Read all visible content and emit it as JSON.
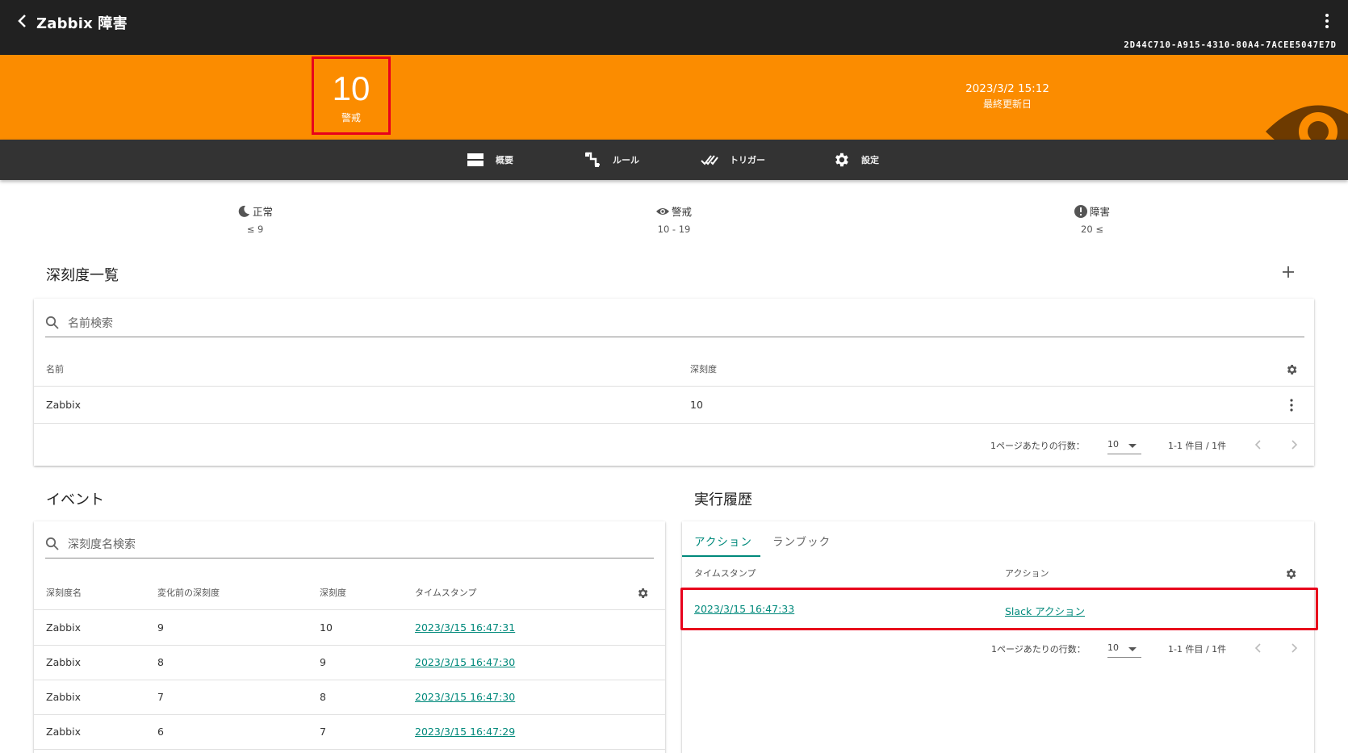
{
  "appbar": {
    "title": "Zabbix 障害",
    "uuid": "2D44C710-A915-4310-80A4-7ACEE5047E7D"
  },
  "banner": {
    "level_value": "10",
    "level_label": "警戒",
    "updated_date": "2023/3/2 15:12",
    "updated_label": "最終更新日",
    "color": "#fb8c00"
  },
  "nav": {
    "items": [
      {
        "label": "概要",
        "icon": "overview-icon"
      },
      {
        "label": "ルール",
        "icon": "rule-icon"
      },
      {
        "label": "トリガー",
        "icon": "trigger-icon"
      },
      {
        "label": "設定",
        "icon": "settings-gear-icon"
      }
    ]
  },
  "thresholds": [
    {
      "label": "正常",
      "range": "≤ 9",
      "icon": "moon-icon"
    },
    {
      "label": "警戒",
      "range": "10 - 19",
      "icon": "eye-icon"
    },
    {
      "label": "障害",
      "range": "20 ≤",
      "icon": "alert-circle-icon"
    }
  ],
  "severity_list": {
    "title": "深刻度一覧",
    "search_placeholder": "名前検索",
    "columns": [
      "名前",
      "深刻度"
    ],
    "rows": [
      {
        "name": "Zabbix",
        "severity": "10"
      }
    ],
    "pager": {
      "rows_per_page_label": "1ページあたりの行数：",
      "rows_per_page": "10",
      "range": "1-1 件目 / 1件"
    }
  },
  "events": {
    "title": "イベント",
    "search_placeholder": "深刻度名検索",
    "columns": [
      "深刻度名",
      "変化前の深刻度",
      "深刻度",
      "タイムスタンプ"
    ],
    "rows": [
      {
        "name": "Zabbix",
        "before": "9",
        "severity": "10",
        "timestamp": "2023/3/15 16:47:31"
      },
      {
        "name": "Zabbix",
        "before": "8",
        "severity": "9",
        "timestamp": "2023/3/15 16:47:30"
      },
      {
        "name": "Zabbix",
        "before": "7",
        "severity": "8",
        "timestamp": "2023/3/15 16:47:30"
      },
      {
        "name": "Zabbix",
        "before": "6",
        "severity": "7",
        "timestamp": "2023/3/15 16:47:29"
      }
    ]
  },
  "history": {
    "title": "実行履歴",
    "tabs": [
      "アクション",
      "ランブック"
    ],
    "columns": [
      "タイムスタンプ",
      "アクション"
    ],
    "rows": [
      {
        "timestamp": "2023/3/15 16:47:33",
        "action": "Slack アクション"
      }
    ],
    "pager": {
      "rows_per_page_label": "1ページあたりの行数：",
      "rows_per_page": "10",
      "range": "1-1 件目 / 1件"
    }
  },
  "colors": {
    "accent": "#00897b",
    "highlight": "#e8001c",
    "nav_bg": "#333333",
    "appbar_bg": "#212121"
  }
}
